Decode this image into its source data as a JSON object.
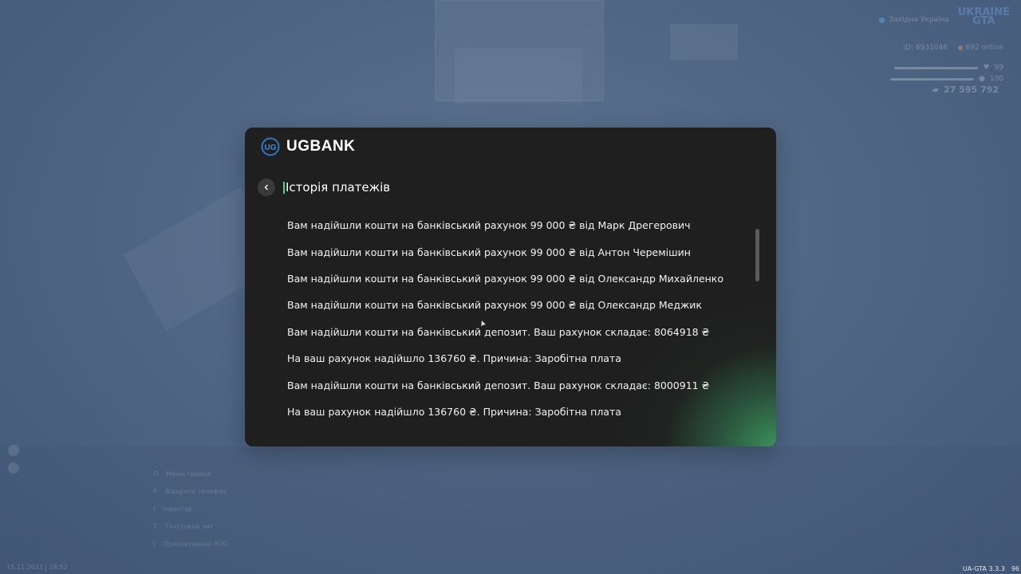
{
  "hud": {
    "server": "Західна Україна",
    "logo_line1": "UKRAINE",
    "logo_line2": "GTA",
    "player_id": "ID: 6931046",
    "online": "692 online",
    "health": "99",
    "armor": "100",
    "money": "27 595 792",
    "time": "15.11.2023 | 18:52",
    "version": "UA-GTA 3.3.3",
    "fps": "96",
    "hints": [
      {
        "key": "O",
        "label": "Меню гравця"
      },
      {
        "key": "P",
        "label": "Відкрити телефон"
      },
      {
        "key": "I",
        "label": "Інвентар"
      },
      {
        "key": "T",
        "label": "Текстовий чат"
      },
      {
        "key": "[",
        "label": "Приховування HUD"
      }
    ]
  },
  "bank": {
    "name": "UGBANK",
    "title": "Історія платежів",
    "transactions": [
      "Вам надійшли кошти на банківський рахунок 99 000 ₴ від Марк Дрегерович",
      "Вам надійшли кошти на банківський рахунок 99 000 ₴ від Антон Черемішин",
      "Вам надійшли кошти на банківський рахунок 99 000 ₴ від Олександр Михайленко",
      "Вам надійшли кошти на банківський рахунок 99 000 ₴ від Олександр Меджик",
      "Вам надійшли кошти на банківський депозит. Ваш рахунок складає: 8064918 ₴",
      "На ваш рахунок надійшло 136760 ₴. Причина: Заробітна плата",
      "Вам надійшли кошти на банківський депозит. Ваш рахунок складає: 8000911 ₴",
      "На ваш рахунок надійшло 136760 ₴. Причина: Заробітна плата"
    ]
  },
  "colors": {
    "accent": "#49d18c",
    "modal_bg": "#1f1f1f",
    "gradient": "#3c965f"
  }
}
